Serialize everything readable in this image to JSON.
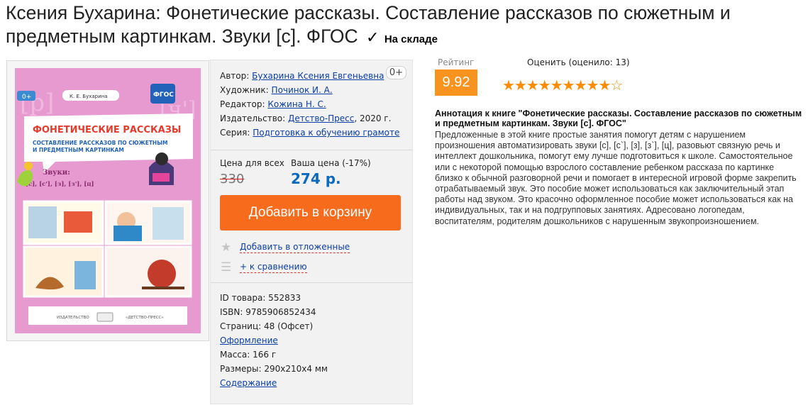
{
  "product": {
    "title": "Ксения Бухарина: Фонетические рассказы. Составление рассказов по сюжетным и предметным картинкам. Звуки [с]. ФГОС",
    "stock_status": "На складе",
    "check_icon": "✓"
  },
  "cover": {
    "author": "К. Е. Бухарина",
    "badge": "ФГОС",
    "age": "0+",
    "title_line": "ФОНЕТИЧЕСКИЕ РАССКАЗЫ",
    "subtitle_line1": "СОСТАВЛЕНИЕ РАССКАЗОВ ПО СЮЖЕТНЫМ",
    "subtitle_line2": "И ПРЕДМЕТНЫМ КАРТИНКАМ",
    "sounds_label": "Звуки:",
    "sounds_list": "[с], [с'], [з], [з'], [ц]",
    "publisher_left": "ИЗДАТЕЛЬСТВО",
    "publisher_right": "«ДЕТСТВО-ПРЕСС»"
  },
  "details": {
    "author_label": "Автор:",
    "author": "Бухарина Ксения Евгеньевна",
    "age_badge": "0+",
    "artist_label": "Художник:",
    "artist": "Починок И. А.",
    "editor_label": "Редактор:",
    "editor": "Кожина Н. С.",
    "publisher_label": "Издательство:",
    "publisher": "Детство-Пресс",
    "year": ", 2020 г.",
    "series_label": "Серия:",
    "series": "Подготовка к обучению грамоте"
  },
  "price": {
    "all_label": "Цена для всех",
    "your_label": "Ваша цена (-17%)",
    "old": "330",
    "new": "274 р."
  },
  "actions": {
    "cart_button": "Добавить в корзину",
    "wishlist": "Добавить в отложенные",
    "compare": "+ к сравнению",
    "star_icon": "★",
    "list_icon": "☰"
  },
  "specs": {
    "id": "ID товара: 552833",
    "isbn": "ISBN: 9785906852434",
    "pages": "Страниц: 48 (Офсет)",
    "design_link": "Оформление",
    "weight": "Масса: 166 г",
    "size": "Размеры: 290x210x4 мм",
    "contents_link": "Содержание"
  },
  "rating": {
    "label": "Рейтинг",
    "value": "9.92",
    "rate_label": "Оценить (оценило: 13)",
    "stars_filled": "★★★★★★★★★",
    "stars_empty": "☆",
    "star_color": "#ff8c00"
  },
  "annotation": {
    "heading": "Аннотация к книге \"Фонетические рассказы. Составление рассказов по сюжетным и предметным картинкам. Звуки [с]. ФГОС\"",
    "body": "Предложенные в этой книге простые занятия помогут детям с нарушением произношения автоматизировать звуки [с], [с`], [з], [з`], [ц], разовьют связную речь и интеллект дошкольника, помогут ему лучше подготовиться к школе. Самостоятельное или с некоторой помощью взрослого составление ребенком рассказа по картинке близко к обычной разговорной речи и помогает в интересной игровой форме закрепить отрабатываемый звук. Это пособие может использоваться как заключительный этап работы над звуком. Это красочно оформленное пособие может использоваться как на индивидуальных, так и на подгрупповых занятиях. Адресовано логопедам, воспитателям, родителям дошкольников с нарушенным звукопроизношением."
  },
  "colors": {
    "cover_pink": "#e69ad0",
    "price_blue": "#0b6abf",
    "cart_orange": "#f76b1c",
    "rating_orange": "#f7931e",
    "link_blue": "#0b3ea5"
  }
}
